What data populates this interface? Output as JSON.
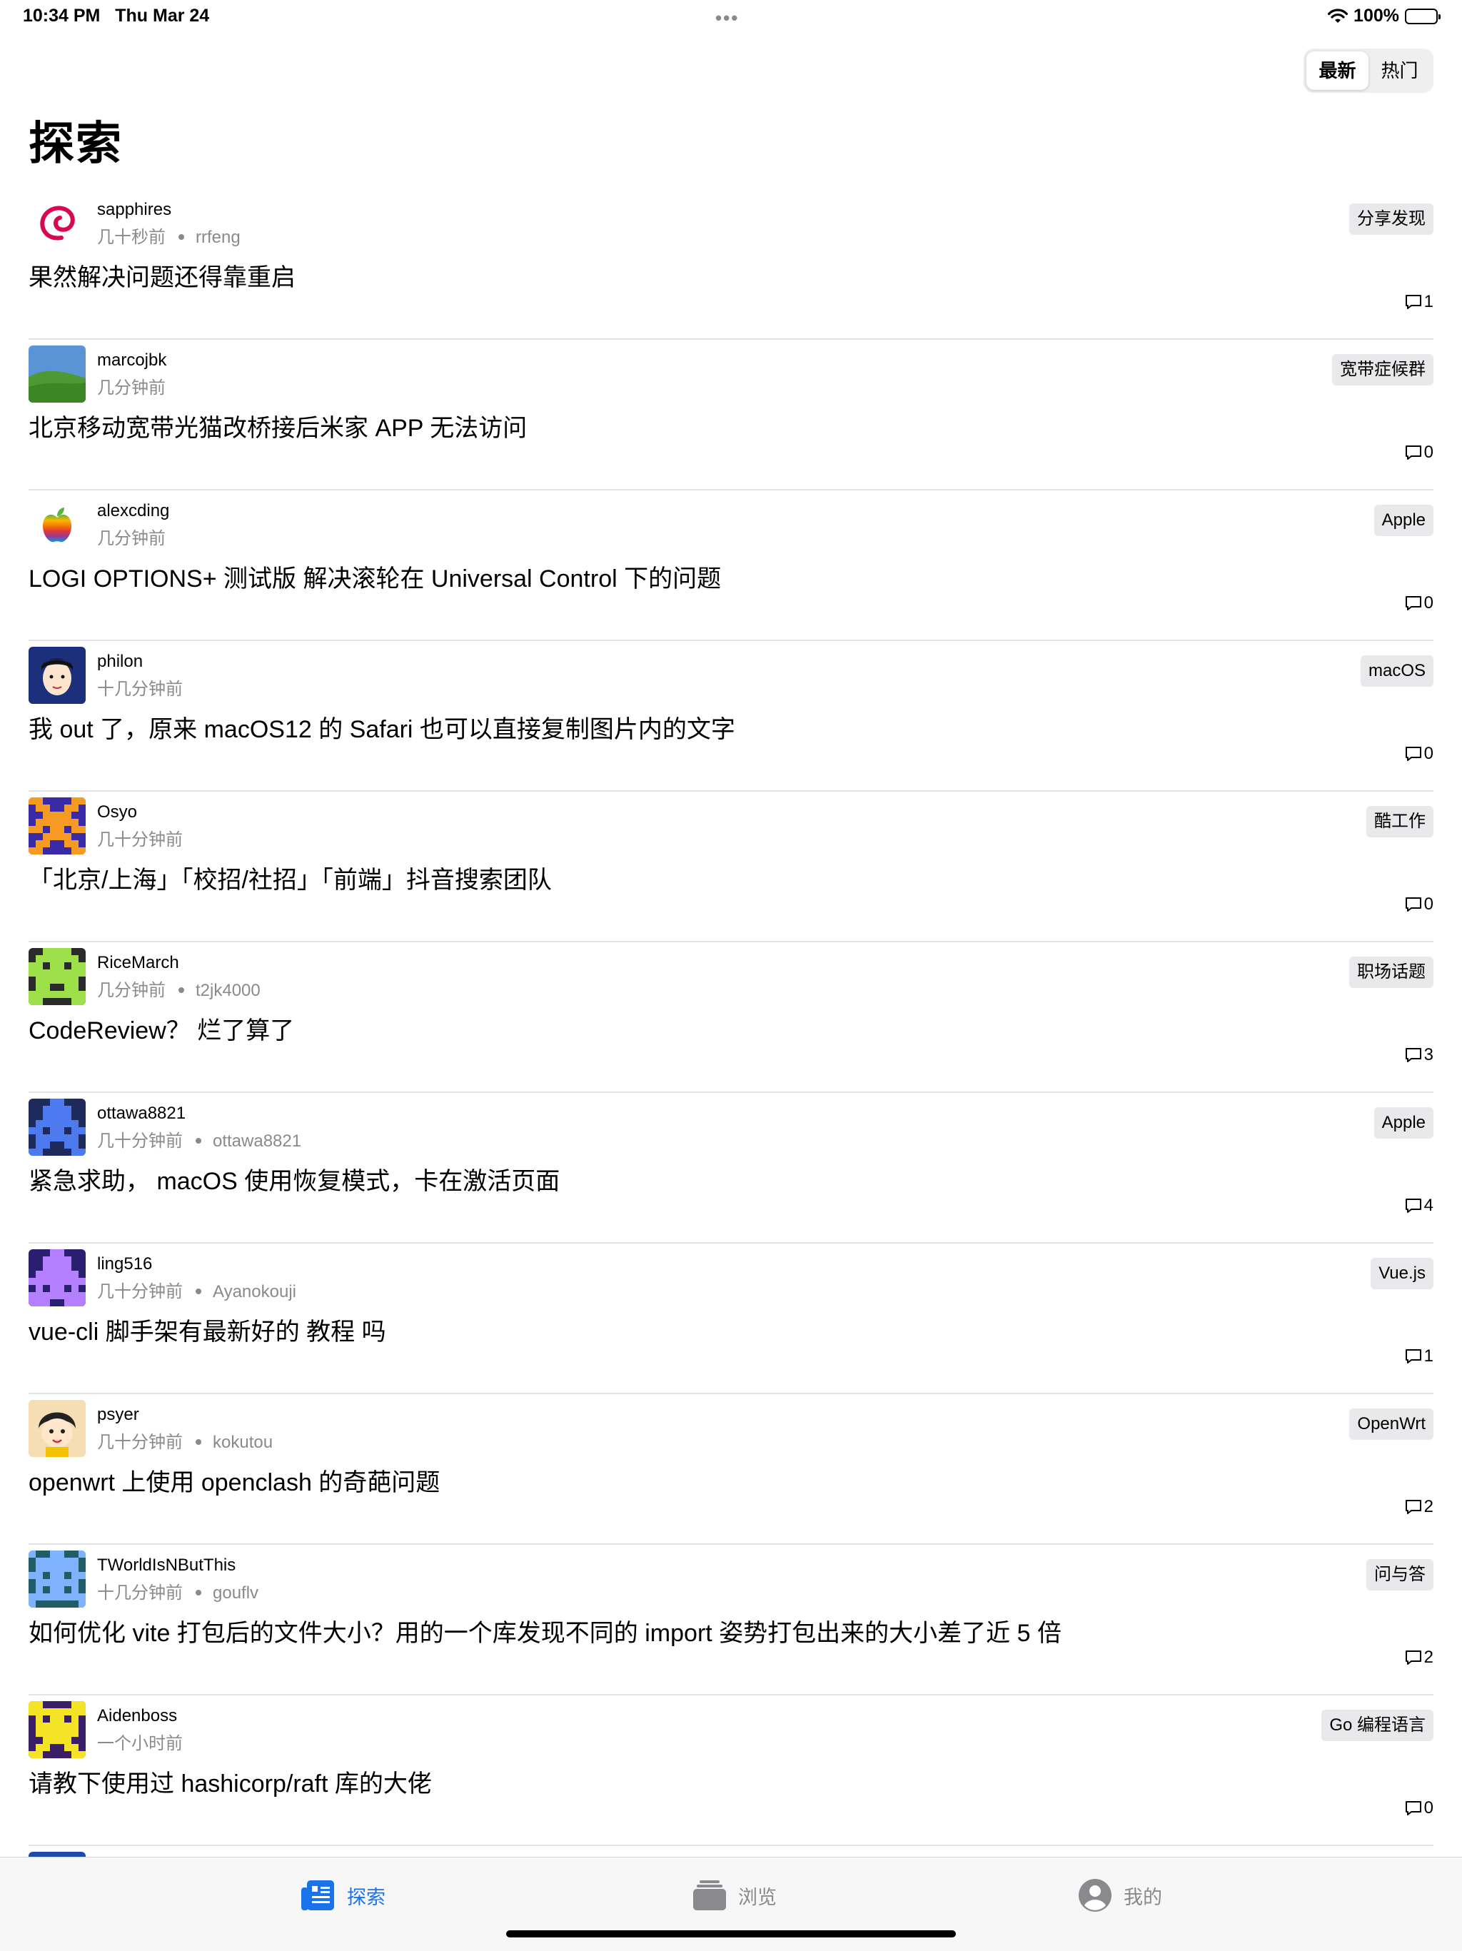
{
  "status_bar": {
    "time": "10:34 PM",
    "date": "Thu Mar 24",
    "battery": "100%",
    "battery_level": 1.0
  },
  "segmented": {
    "latest": "最新",
    "hot": "热门",
    "selected": "latest"
  },
  "page_title": "探索",
  "posts": [
    {
      "user": "sapphires",
      "time": "几十秒前",
      "reply_user": "rrfeng",
      "title": "果然解决问题还得靠重启",
      "tag": "分享发现",
      "comments": "1",
      "avatar": "debian-swirl"
    },
    {
      "user": "marcojbk",
      "time": "几分钟前",
      "reply_user": "",
      "title": "北京移动宽带光猫改桥接后米家 APP 无法访问",
      "tag": "宽带症候群",
      "comments": "0",
      "avatar": "bliss-landscape"
    },
    {
      "user": "alexcding",
      "time": "几分钟前",
      "reply_user": "",
      "title": "LOGI OPTIONS+ 测试版 解决滚轮在 Universal Control 下的问题",
      "tag": "Apple",
      "comments": "0",
      "avatar": "apple-logo"
    },
    {
      "user": "philon",
      "time": "十几分钟前",
      "reply_user": "",
      "title": "我 out 了，原来 macOS12 的 Safari 也可以直接复制图片内的文字",
      "tag": "macOS",
      "comments": "0",
      "avatar": "cartoon-face"
    },
    {
      "user": "Osyo",
      "time": "几十分钟前",
      "reply_user": "",
      "title": "「北京/上海」「校招/社招」「前端」抖音搜索团队",
      "tag": "酷工作",
      "comments": "0",
      "avatar": "pixel-orange"
    },
    {
      "user": "RiceMarch",
      "time": "几分钟前",
      "reply_user": "t2jk4000",
      "title": "CodeReview？ 烂了算了",
      "tag": "职场话题",
      "comments": "3",
      "avatar": "pixel-green"
    },
    {
      "user": "ottawa8821",
      "time": "几十分钟前",
      "reply_user": "ottawa8821",
      "title": "紧急求助， macOS 使用恢复模式，卡在激活页面",
      "tag": "Apple",
      "comments": "4",
      "avatar": "pixel-blue"
    },
    {
      "user": "ling516",
      "time": "几十分钟前",
      "reply_user": "Ayanokouji",
      "title": "vue-cli 脚手架有最新好的 教程 吗",
      "tag": "Vue.js",
      "comments": "1",
      "avatar": "pixel-purple"
    },
    {
      "user": "psyer",
      "time": "几十分钟前",
      "reply_user": "kokutou",
      "title": "openwrt 上使用 openclash 的奇葩问题",
      "tag": "OpenWrt",
      "comments": "2",
      "avatar": "cartoon-kid"
    },
    {
      "user": "TWorldIsNButThis",
      "time": "十几分钟前",
      "reply_user": "gouflv",
      "title": "如何优化 vite 打包后的文件大小？用的一个库发现不同的 import 姿势打包出来的大小差了近 5 倍",
      "tag": "问与答",
      "comments": "2",
      "avatar": "pixel-teal"
    },
    {
      "user": "Aidenboss",
      "time": "一个小时前",
      "reply_user": "",
      "title": "请教下使用过 hashicorp/raft 库的大佬",
      "tag": "Go 编程语言",
      "comments": "0",
      "avatar": "pixel-yellow"
    }
  ],
  "tabs": [
    {
      "label": "探索",
      "icon": "newspaper-icon",
      "active": true
    },
    {
      "label": "浏览",
      "icon": "stack-icon",
      "active": false
    },
    {
      "label": "我的",
      "icon": "person-circle-icon",
      "active": false
    }
  ],
  "colors": {
    "accent": "#1a73e8",
    "secondary_text": "#8a8a8e",
    "tag_bg": "#e9e9eb",
    "separator": "#e2e2e4"
  }
}
